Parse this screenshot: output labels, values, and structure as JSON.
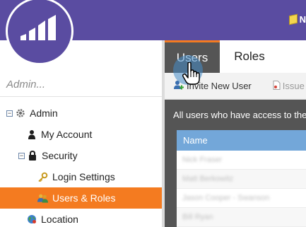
{
  "topbar": {
    "note_label": "N",
    "brand_color": "#5a4ca1",
    "icons": [
      "marketo-logo-icon",
      "sticky-note-icon"
    ]
  },
  "sidebar": {
    "search_placeholder": "Admin...",
    "items": [
      {
        "label": "Admin",
        "icon": "gear-icon",
        "toggle": "minus"
      },
      {
        "label": "My Account",
        "icon": "person-icon"
      },
      {
        "label": "Security",
        "icon": "lock-icon",
        "toggle": "minus"
      },
      {
        "label": "Login Settings",
        "icon": "key-icon"
      },
      {
        "label": "Users & Roles",
        "icon": "users-icon",
        "selected": true
      },
      {
        "label": "Location",
        "icon": "globe-icon"
      }
    ],
    "accent_color": "#f47b20"
  },
  "main": {
    "tabs": [
      {
        "label": "Users",
        "active": true
      },
      {
        "label": "Roles",
        "active": false
      }
    ],
    "toolbar": {
      "create_label": "Invite New User",
      "issue_label": "Issue"
    },
    "header_text": "All users who have access to the",
    "grid": {
      "columns": [
        "Name"
      ],
      "header_color": "#73a7d9",
      "rows": [
        "Nick Fraser",
        "Matt Berkowitz",
        "Jason Cooper - Swanson",
        "Bill Ryan"
      ]
    }
  },
  "cursor": {
    "icon": "hand-pointer-icon"
  }
}
